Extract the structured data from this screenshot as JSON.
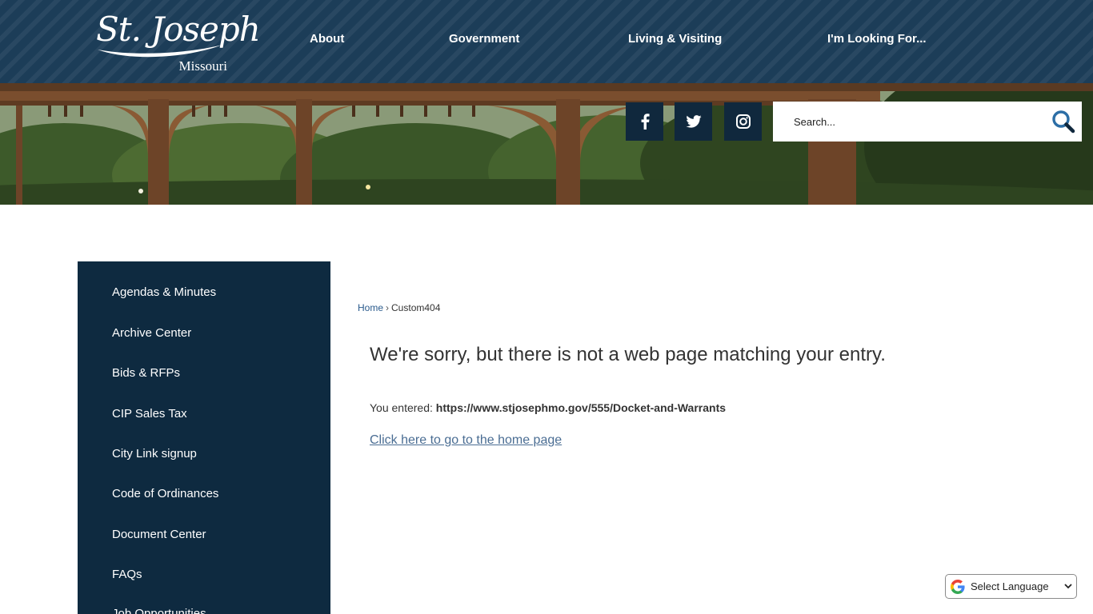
{
  "header": {
    "logo": {
      "title": "St. Joseph",
      "subtitle": "Missouri"
    },
    "nav": [
      {
        "label": "About"
      },
      {
        "label": "Government"
      },
      {
        "label": "Living & Visiting"
      },
      {
        "label": "I'm Looking For..."
      }
    ]
  },
  "banner": {
    "social": [
      {
        "icon": "facebook-icon"
      },
      {
        "icon": "twitter-icon"
      },
      {
        "icon": "instagram-icon"
      }
    ],
    "search": {
      "placeholder": "Search...",
      "icon": "search-icon"
    }
  },
  "sidebar": {
    "items": [
      {
        "label": "Agendas & Minutes"
      },
      {
        "label": "Archive Center"
      },
      {
        "label": "Bids & RFPs"
      },
      {
        "label": "CIP Sales Tax"
      },
      {
        "label": "City Link signup"
      },
      {
        "label": "Code of Ordinances"
      },
      {
        "label": "Document Center"
      },
      {
        "label": "FAQs"
      },
      {
        "label": "Job Opportunities"
      }
    ]
  },
  "main": {
    "breadcrumb": {
      "home": "Home",
      "separator": "›",
      "current": "Custom404"
    },
    "heading": "We're sorry, but there is not a web page matching your entry.",
    "entered_label": "You entered:",
    "entered_url": "https://www.stjosephmo.gov/555/Docket-and-Warrants",
    "home_link": "Click here to go to the home page"
  },
  "translate": {
    "label": "Select Language",
    "icon": "google-g-icon"
  },
  "colors": {
    "header": "#1c3d58",
    "sidebar": "#0e2a40",
    "social_bg": "#10283d",
    "search_icon": "#2c6ea6",
    "link": "#4a6d93"
  }
}
